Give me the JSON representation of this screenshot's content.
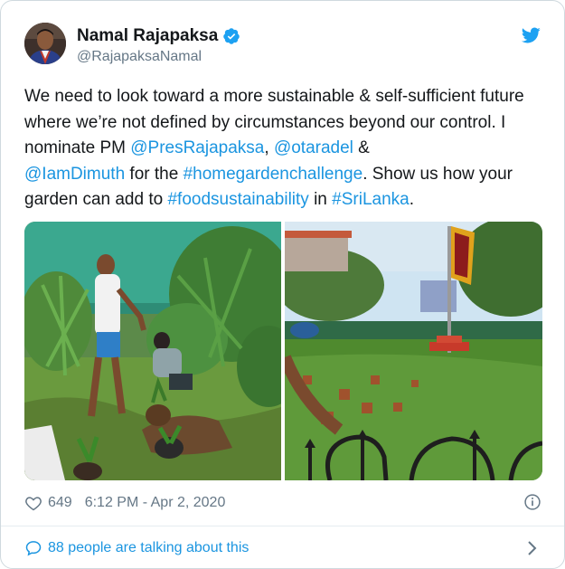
{
  "author": {
    "name": "Namal Rajapaksa",
    "handle": "@RajapaksaNamal"
  },
  "tweet": {
    "part1": "We need to look toward a more sustainable & self-sufficient future where we’re not defined by circumstances beyond our control. I nominate PM ",
    "mention1": "@PresRajapaksa",
    "sep1": ", ",
    "mention2": "@otaradel",
    "sep2": " & ",
    "mention3": "@IamDimuth",
    "part2": " for the ",
    "hashtag1": "#homegardenchallenge",
    "part3": ". Show us how your garden can add to ",
    "hashtag2": "#foodsustainability",
    "part4": " in ",
    "hashtag3": "#SriLanka",
    "part5": "."
  },
  "footer": {
    "likes": "649",
    "timestamp": "6:12 PM - Apr 2, 2020",
    "talking": "88 people are talking about this"
  },
  "icons": {
    "verified": "verified-badge-icon",
    "twitter": "twitter-bird-icon",
    "like": "heart-icon",
    "info": "info-icon",
    "reply": "speech-bubble-icon",
    "chevron": "chevron-right-icon"
  },
  "colors": {
    "link": "#1b95e0",
    "text": "#14171a",
    "muted": "#657786"
  }
}
